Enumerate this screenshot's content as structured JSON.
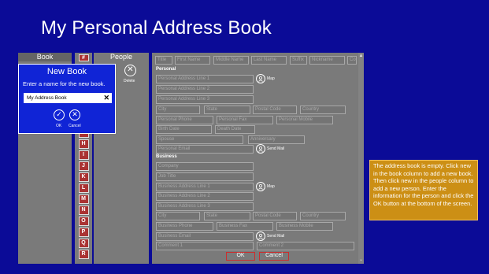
{
  "app": {
    "title": "My Personal Address Book"
  },
  "book_column": {
    "header": "Book"
  },
  "alphabet": [
    "#",
    "G",
    "H",
    "I",
    "J",
    "K",
    "L",
    "M",
    "N",
    "O",
    "P",
    "Q",
    "R"
  ],
  "people_column": {
    "header": "People",
    "delete_label": "Delete"
  },
  "detail": {
    "name_fields": [
      "Title",
      "First Name",
      "Middle Name",
      "Last Name",
      "Suffix",
      "Nickname",
      "Co"
    ],
    "personal_header": "Personal",
    "personal_lines": [
      "Personal Address Line 1",
      "Personal Address Line 2",
      "Personal Address Line 3"
    ],
    "personal_city": "City",
    "personal_state": "State",
    "personal_postal": "Postal Code",
    "personal_country": "Country",
    "personal_phone": "Personal Phone",
    "personal_fax": "Personal Fax",
    "personal_mobile": "Personal Mobile",
    "birth_date": "Birth Date",
    "death_date": "Death Date",
    "spouse": "Spouse",
    "anniversary": "Anniversary",
    "personal_email": "Personal Email",
    "map_label": "Map",
    "send_mail_label": "Send Mail",
    "business_header": "Business",
    "company": "Company",
    "job_title": "Job Title",
    "business_lines": [
      "Business Address Line 1",
      "Business Address Line 2",
      "Business Address Line 3"
    ],
    "business_city": "City",
    "business_state": "State",
    "business_postal": "Postal Code",
    "business_country": "Country",
    "business_phone": "Business Phone",
    "business_fax": "Business Fax",
    "business_mobile": "Business Mobile",
    "business_email": "Business Email",
    "comment1": "Comment 1",
    "comment2": "Comment 2",
    "ok_label": "OK",
    "cancel_label": "Cancel"
  },
  "dialog": {
    "title": "New Book",
    "message": "Enter a name for the new book.",
    "input_value": "My Address Book",
    "ok_label": "OK",
    "cancel_label": "Cancel"
  },
  "info": {
    "text": "The address book is empty. Click new in the book column to add a new book.  Then click new in the people column to add a new person.  Enter the information for the person and click the OK button at the bottom of the screen."
  },
  "colors": {
    "background": "#0b0b97",
    "dialog": "#1024d6",
    "info": "#cc8f15",
    "accent_red": "#cc2d2d"
  }
}
